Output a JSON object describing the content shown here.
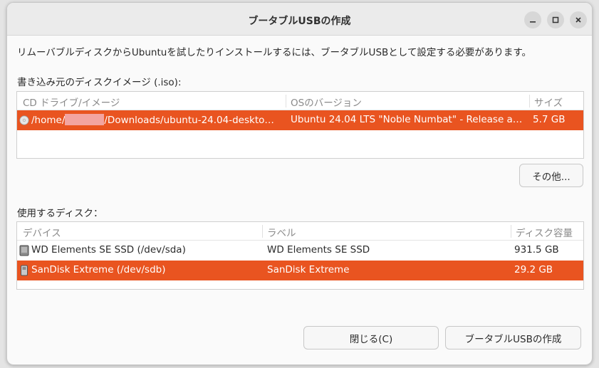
{
  "window": {
    "title": "ブータブルUSBの作成"
  },
  "intro_text": "リムーバブルディスクからUbuntuを試したりインストールするには、ブータブルUSBとして設定する必要があります。",
  "iso_section": {
    "label": "書き込み元のディスクイメージ (.iso):",
    "columns": [
      "CD ドライブ/イメージ",
      "OSのバージョン",
      "サイズ"
    ],
    "rows": [
      {
        "path_prefix": "/home/",
        "path_suffix": "/Downloads/ubuntu-24.04-deskto…",
        "os_version": "Ubuntu 24.04 LTS \"Noble Numbat\" - Release a…",
        "size": "5.7 GB",
        "selected": true
      }
    ],
    "other_button": "その他..."
  },
  "disk_section": {
    "label": "使用するディスク：",
    "columns": [
      "デバイス",
      "ラベル",
      "ディスク容量"
    ],
    "rows": [
      {
        "device": "WD Elements SE SSD (/dev/sda)",
        "label": "WD Elements SE SSD",
        "capacity": "931.5 GB",
        "selected": false
      },
      {
        "device": "SanDisk Extreme (/dev/sdb)",
        "label": "SanDisk Extreme",
        "capacity": "29.2 GB",
        "selected": true
      }
    ]
  },
  "footer": {
    "close_button": "閉じる(C)",
    "create_button": "ブータブルUSBの作成"
  },
  "colors": {
    "selection": "#e95420",
    "redaction": "#f3a4a0"
  },
  "icons": {
    "minimize": "minimize-icon",
    "maximize": "maximize-icon",
    "close": "close-icon",
    "disc": "disc-icon",
    "drive": "drive-icon",
    "usb": "usb-drive-icon"
  }
}
